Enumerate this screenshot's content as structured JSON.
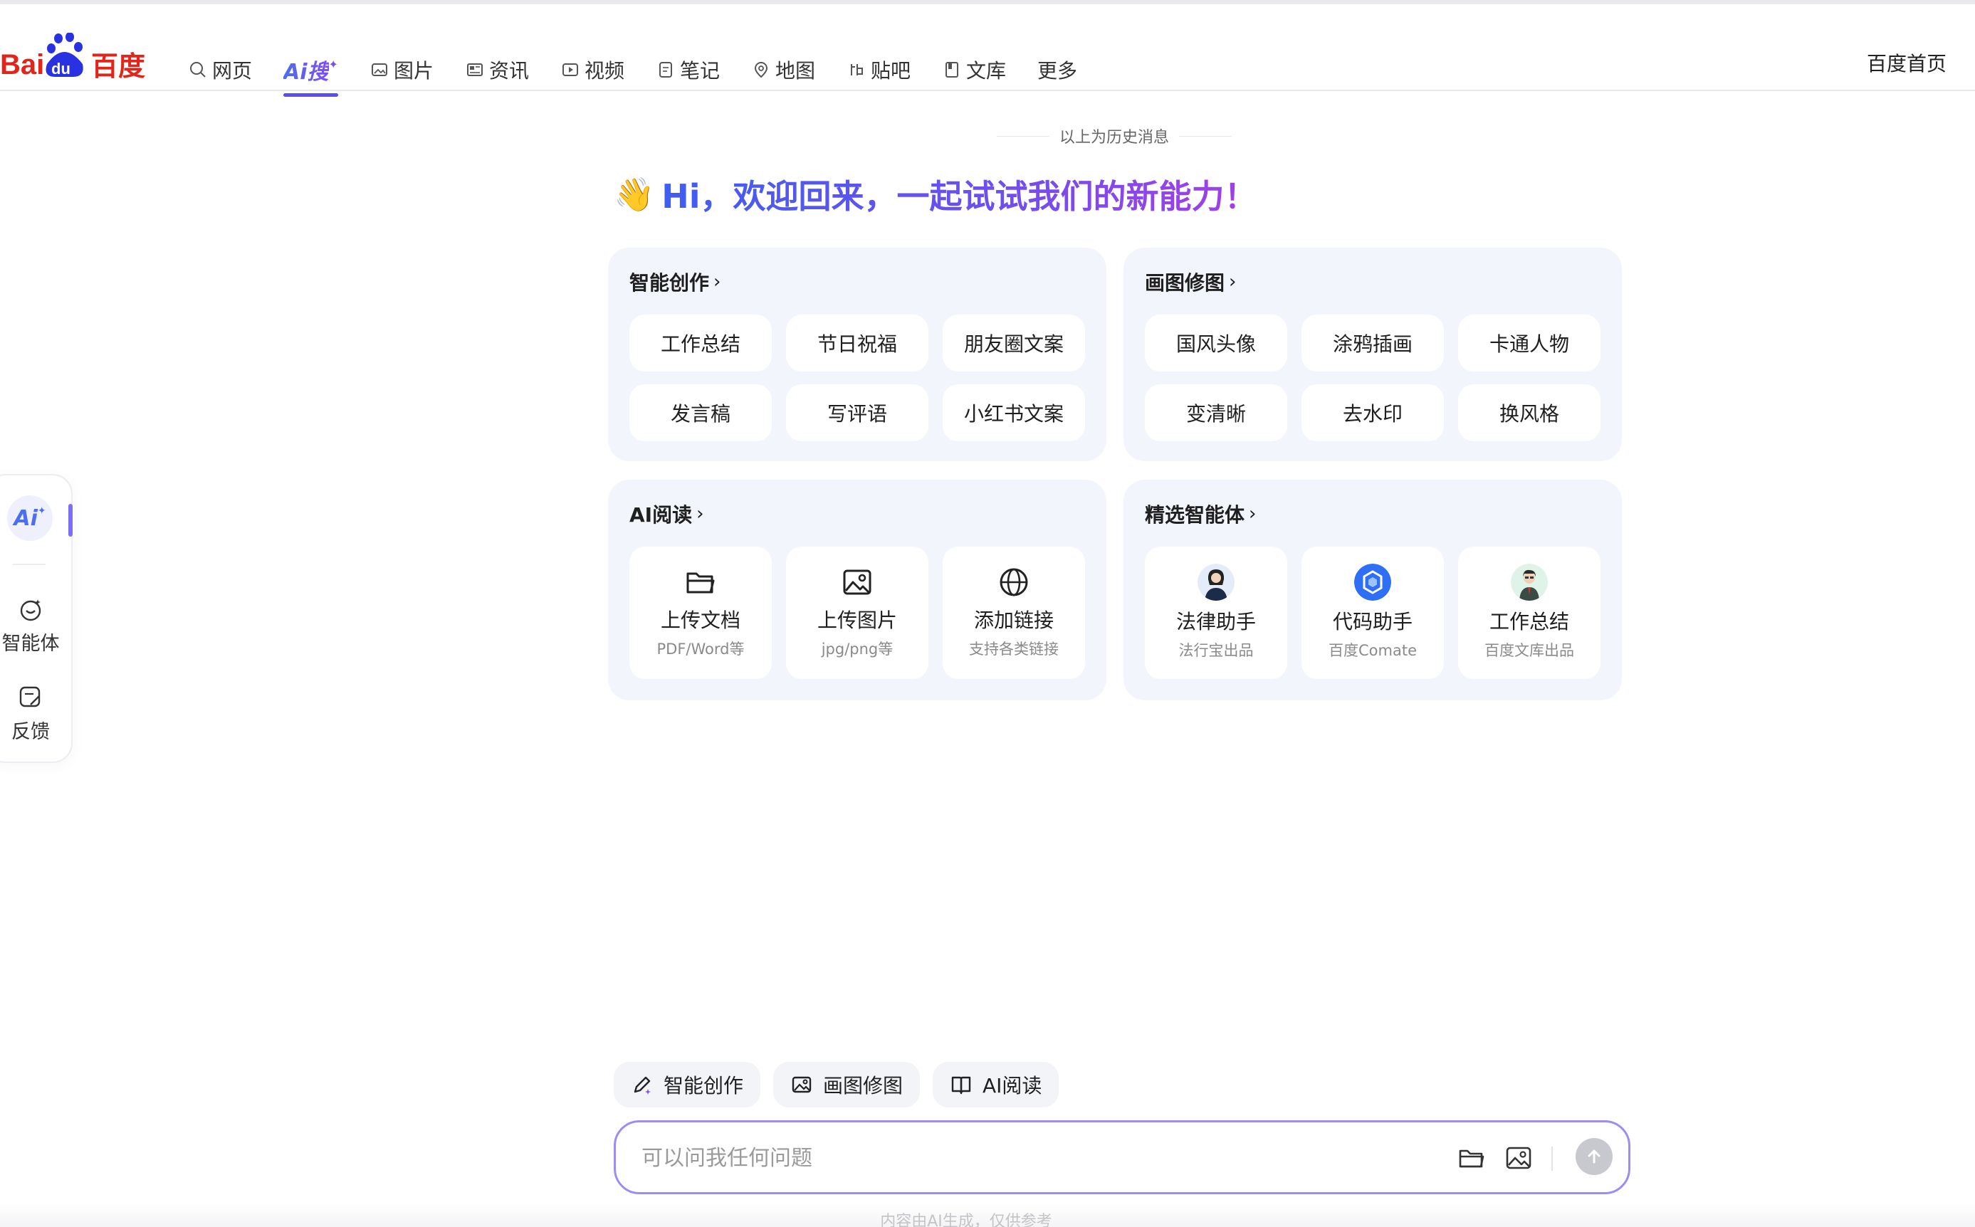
{
  "header": {
    "logo_text": "Bai du 百度",
    "nav": [
      {
        "label": "网页",
        "icon": "search-icon"
      },
      {
        "label": "Ai搜",
        "icon": "ai-search-icon",
        "active": true
      },
      {
        "label": "图片",
        "icon": "image-icon"
      },
      {
        "label": "资讯",
        "icon": "news-icon"
      },
      {
        "label": "视频",
        "icon": "video-icon"
      },
      {
        "label": "笔记",
        "icon": "note-icon"
      },
      {
        "label": "地图",
        "icon": "map-icon"
      },
      {
        "label": "贴吧",
        "icon": "tieba-icon"
      },
      {
        "label": "文库",
        "icon": "wenku-icon"
      },
      {
        "label": "更多",
        "icon": ""
      }
    ],
    "home_link": "百度首页"
  },
  "rail": {
    "ai_label": "Ai",
    "items": [
      {
        "label": "智能体",
        "icon": "agent-icon"
      },
      {
        "label": "反馈",
        "icon": "feedback-icon"
      }
    ]
  },
  "history_separator": "以上为历史消息",
  "greeting": {
    "emoji": "👋",
    "text": "Hi，欢迎回来，一起试试我们的新能力！"
  },
  "cards": {
    "creation": {
      "title": "智能创作",
      "items": [
        "工作总结",
        "节日祝福",
        "朋友圈文案",
        "发言稿",
        "写评语",
        "小红书文案"
      ]
    },
    "drawing": {
      "title": "画图修图",
      "items": [
        "国风头像",
        "涂鸦插画",
        "卡通人物",
        "变清晰",
        "去水印",
        "换风格"
      ]
    },
    "reading": {
      "title": "AI阅读",
      "items": [
        {
          "title": "上传文档",
          "sub": "PDF/Word等",
          "icon": "folder-icon"
        },
        {
          "title": "上传图片",
          "sub": "jpg/png等",
          "icon": "image-icon"
        },
        {
          "title": "添加链接",
          "sub": "支持各类链接",
          "icon": "globe-icon"
        }
      ]
    },
    "agents": {
      "title": "精选智能体",
      "items": [
        {
          "title": "法律助手",
          "sub": "法行宝出品",
          "icon": "lawyer-avatar"
        },
        {
          "title": "代码助手",
          "sub": "百度Comate",
          "icon": "comate-logo"
        },
        {
          "title": "工作总结",
          "sub": "百度文库出品",
          "icon": "worker-avatar"
        }
      ]
    }
  },
  "quick_actions": [
    "智能创作",
    "画图修图",
    "AI阅读"
  ],
  "input": {
    "placeholder": "可以问我任何问题",
    "value": ""
  },
  "disclaimer": "内容由AI生成，仅供参考",
  "colors": {
    "accent": "#4e6ef2",
    "purple": "#7b4cf3",
    "card_bg": "#f3f5fd",
    "input_border": "#9f8cf0"
  }
}
